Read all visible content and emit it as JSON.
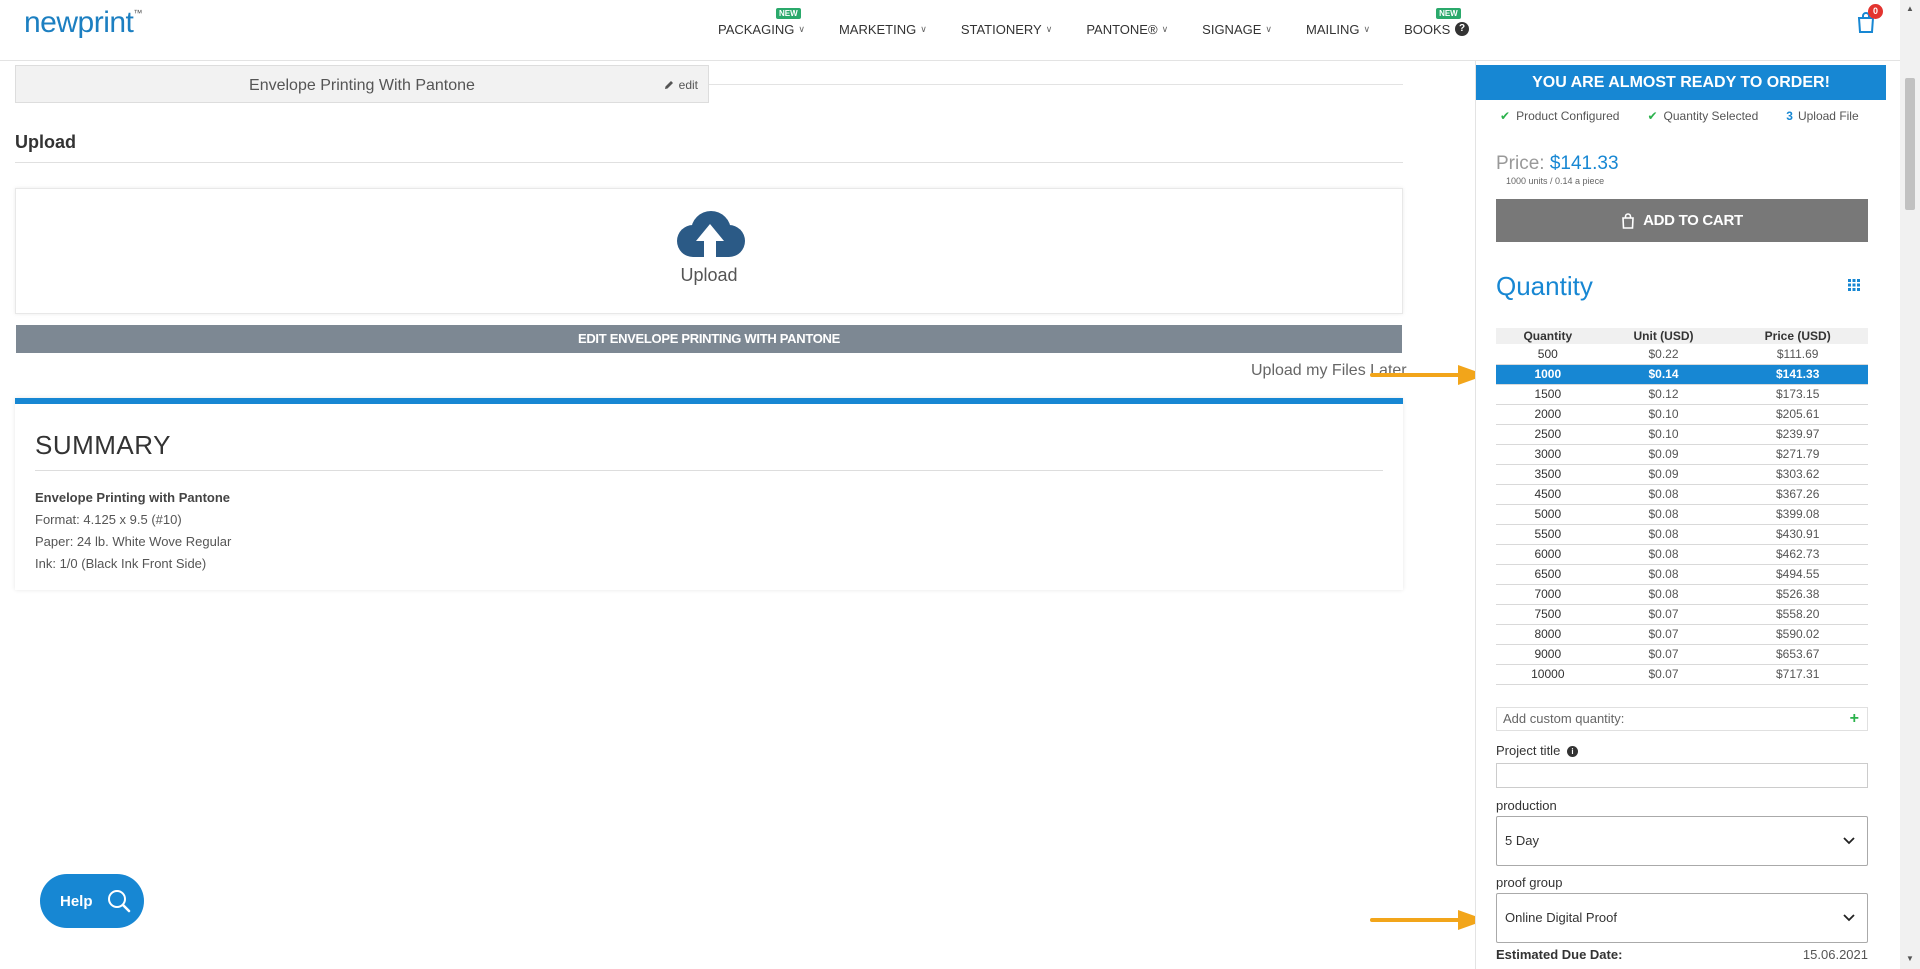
{
  "header": {
    "logo": "newprint",
    "logo_tm": "™",
    "nav": [
      {
        "label": "PACKAGING",
        "badge": "NEW"
      },
      {
        "label": "MARKETING",
        "badge": ""
      },
      {
        "label": "STATIONERY",
        "badge": ""
      },
      {
        "label": "PANTONE®",
        "badge": ""
      },
      {
        "label": "SIGNAGE",
        "badge": ""
      },
      {
        "label": "MAILING",
        "badge": ""
      },
      {
        "label": "BOOKS",
        "badge": "NEW"
      }
    ],
    "help_glyph": "?",
    "cart_count": "0"
  },
  "product_bar": {
    "title": "Envelope Printing With Pantone",
    "edit_label": "edit"
  },
  "upload": {
    "heading": "Upload",
    "box_label": "Upload",
    "edit_button": "EDIT ENVELOPE PRINTING WITH PANTONE",
    "later_link": "Upload my Files Later"
  },
  "summary": {
    "title": "SUMMARY",
    "product": "Envelope Printing with Pantone",
    "format": "Format: 4.125 x 9.5 (#10)",
    "paper": "Paper: 24 lb. White Wove Regular",
    "ink": "Ink: 1/0 (Black Ink Front Side)"
  },
  "help_button": "Help",
  "order_panel": {
    "banner": "YOU ARE ALMOST READY TO ORDER!",
    "steps": [
      {
        "mark": "✔",
        "label": "Product Configured"
      },
      {
        "mark": "✔",
        "label": "Quantity Selected"
      },
      {
        "mark": "3",
        "label": "Upload File"
      }
    ],
    "price_label": "Price:",
    "price_value": "$141.33",
    "price_sub": "1000 units / 0.14 a piece",
    "add_to_cart": "ADD TO CART",
    "quantity_title": "Quantity",
    "table_headers": [
      "Quantity",
      "Unit (USD)",
      "Price (USD)"
    ],
    "selected_quantity": "1000",
    "rows": [
      [
        "500",
        "$0.22",
        "$111.69"
      ],
      [
        "1000",
        "$0.14",
        "$141.33"
      ],
      [
        "1500",
        "$0.12",
        "$173.15"
      ],
      [
        "2000",
        "$0.10",
        "$205.61"
      ],
      [
        "2500",
        "$0.10",
        "$239.97"
      ],
      [
        "3000",
        "$0.09",
        "$271.79"
      ],
      [
        "3500",
        "$0.09",
        "$303.62"
      ],
      [
        "4500",
        "$0.08",
        "$367.26"
      ],
      [
        "5000",
        "$0.08",
        "$399.08"
      ],
      [
        "5500",
        "$0.08",
        "$430.91"
      ],
      [
        "6000",
        "$0.08",
        "$462.73"
      ],
      [
        "6500",
        "$0.08",
        "$494.55"
      ],
      [
        "7000",
        "$0.08",
        "$526.38"
      ],
      [
        "7500",
        "$0.07",
        "$558.20"
      ],
      [
        "8000",
        "$0.07",
        "$590.02"
      ],
      [
        "9000",
        "$0.07",
        "$653.67"
      ],
      [
        "10000",
        "$0.07",
        "$717.31"
      ]
    ],
    "custom_quantity_placeholder": "Add custom quantity:",
    "custom_quantity_plus": "+",
    "project_title_label": "Project title",
    "project_title_value": "",
    "info_glyph": "i",
    "production_label": "production",
    "production_value": "5 Day",
    "proof_group_label": "proof group",
    "proof_group_value": "Online Digital Proof",
    "due_label": "Estimated Due Date:",
    "due_value": "15.06.2021"
  },
  "colors": {
    "accent": "#1787d3",
    "arrow": "#f2a51a",
    "check": "#2bb24c",
    "cart_badge": "#e3342f",
    "new_badge": "#2aa96b",
    "button_gray": "#787878"
  }
}
